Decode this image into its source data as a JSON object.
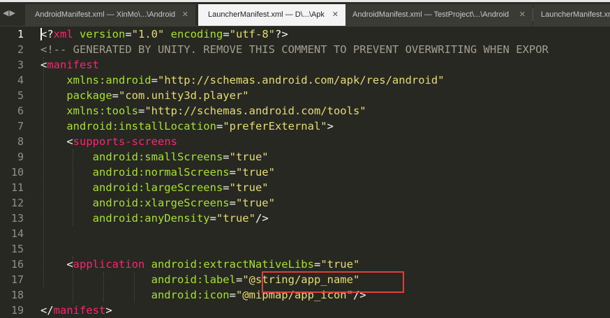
{
  "tabs": [
    {
      "label": "AndroidManifest.xml — XinMo\\...\\Android",
      "close": "✕",
      "active": false
    },
    {
      "label": "LauncherManifest.xml — D\\...\\Apk",
      "close": "✕",
      "active": true
    },
    {
      "label": "AndroidManifest.xml — TestProject\\...\\Android",
      "close": "✕",
      "active": false
    },
    {
      "label": "LauncherManifest.xml",
      "close": "",
      "active": false
    }
  ],
  "nav": {
    "prev": "◀",
    "next": "▶"
  },
  "line_numbers": [
    "1",
    "2",
    "3",
    "4",
    "5",
    "6",
    "7",
    "8",
    "9",
    "10",
    "11",
    "12",
    "13",
    "14",
    "15",
    "16",
    "17",
    "18",
    "19"
  ],
  "current_line": 1,
  "code": {
    "l1": {
      "p1": "<?",
      "p2": "xml",
      "p3": " version",
      "p4": "=",
      "p5": "\"1.0\"",
      "p6": " encoding",
      "p7": "=",
      "p8": "\"utf-8\"",
      "p9": "?>"
    },
    "l2": {
      "p1": "<!-- GENERATED BY UNITY. REMOVE THIS COMMENT TO PREVENT OVERWRITING WHEN EXPOR"
    },
    "l3": {
      "p1": "<",
      "p2": "manifest"
    },
    "l4": {
      "p1": "    xmlns:android",
      "p2": "=",
      "p3": "\"http://schemas.android.com/apk/res/android\""
    },
    "l5": {
      "p1": "    package",
      "p2": "=",
      "p3": "\"com.unity3d.player\""
    },
    "l6": {
      "p1": "    xmlns:tools",
      "p2": "=",
      "p3": "\"http://schemas.android.com/tools\""
    },
    "l7": {
      "p1": "    android:installLocation",
      "p2": "=",
      "p3": "\"preferExternal\"",
      "p4": ">"
    },
    "l8": {
      "p1": "    <",
      "p2": "supports-screens"
    },
    "l9": {
      "p1": "        android:smallScreens",
      "p2": "=",
      "p3": "\"true\""
    },
    "l10": {
      "p1": "        android:normalScreens",
      "p2": "=",
      "p3": "\"true\""
    },
    "l11": {
      "p1": "        android:largeScreens",
      "p2": "=",
      "p3": "\"true\""
    },
    "l12": {
      "p1": "        android:xlargeScreens",
      "p2": "=",
      "p3": "\"true\""
    },
    "l13": {
      "p1": "        android:anyDensity",
      "p2": "=",
      "p3": "\"true\"",
      "p4": "/>"
    },
    "l15": {
      "p1": "    <",
      "p2": "application",
      "p3": " android:extractNativeLibs",
      "p4": "=",
      "p5": "\"true\""
    },
    "l16": {
      "p1": "                 android:label",
      "p2": "=",
      "p3": "\"@string/app_name\""
    },
    "l17": {
      "p1": "                 android:icon",
      "p2": "=",
      "p3": "\"@mipmap/app_icon\"",
      "p4": "/>"
    },
    "l18": {
      "p1": "</",
      "p2": "manifest",
      "p3": ">"
    }
  },
  "colors": {
    "background": "#272822",
    "tag": "#f92672",
    "attribute": "#a6e22e",
    "string": "#e6db74",
    "highlight_box": "#e0403c"
  }
}
